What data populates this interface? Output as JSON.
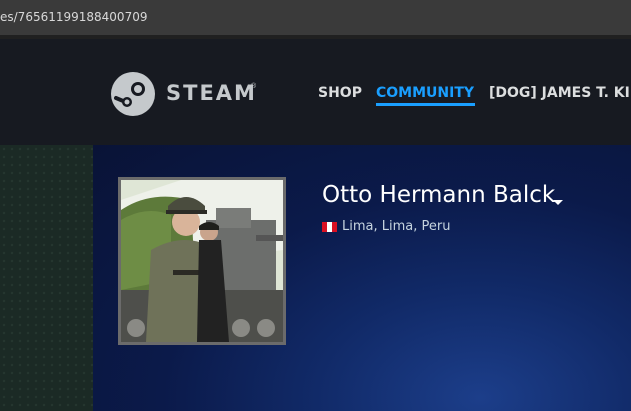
{
  "browser": {
    "url_text": "es/76561199188400709"
  },
  "header": {
    "logo_text": "STEAM",
    "nav": {
      "shop": "SHOP",
      "community": "COMMUNITY",
      "user": "[DOG] JAMES T. KIF"
    },
    "active_tab": "COMMUNITY"
  },
  "profile": {
    "persona_name": "Otto Hermann Balck",
    "location": "Lima, Lima, Peru",
    "flag": "peru-flag"
  },
  "colors": {
    "header_bg": "#171a21",
    "accent": "#1a9fff",
    "profile_bg": "#0b1a4a",
    "text_light": "#dcdedf"
  }
}
